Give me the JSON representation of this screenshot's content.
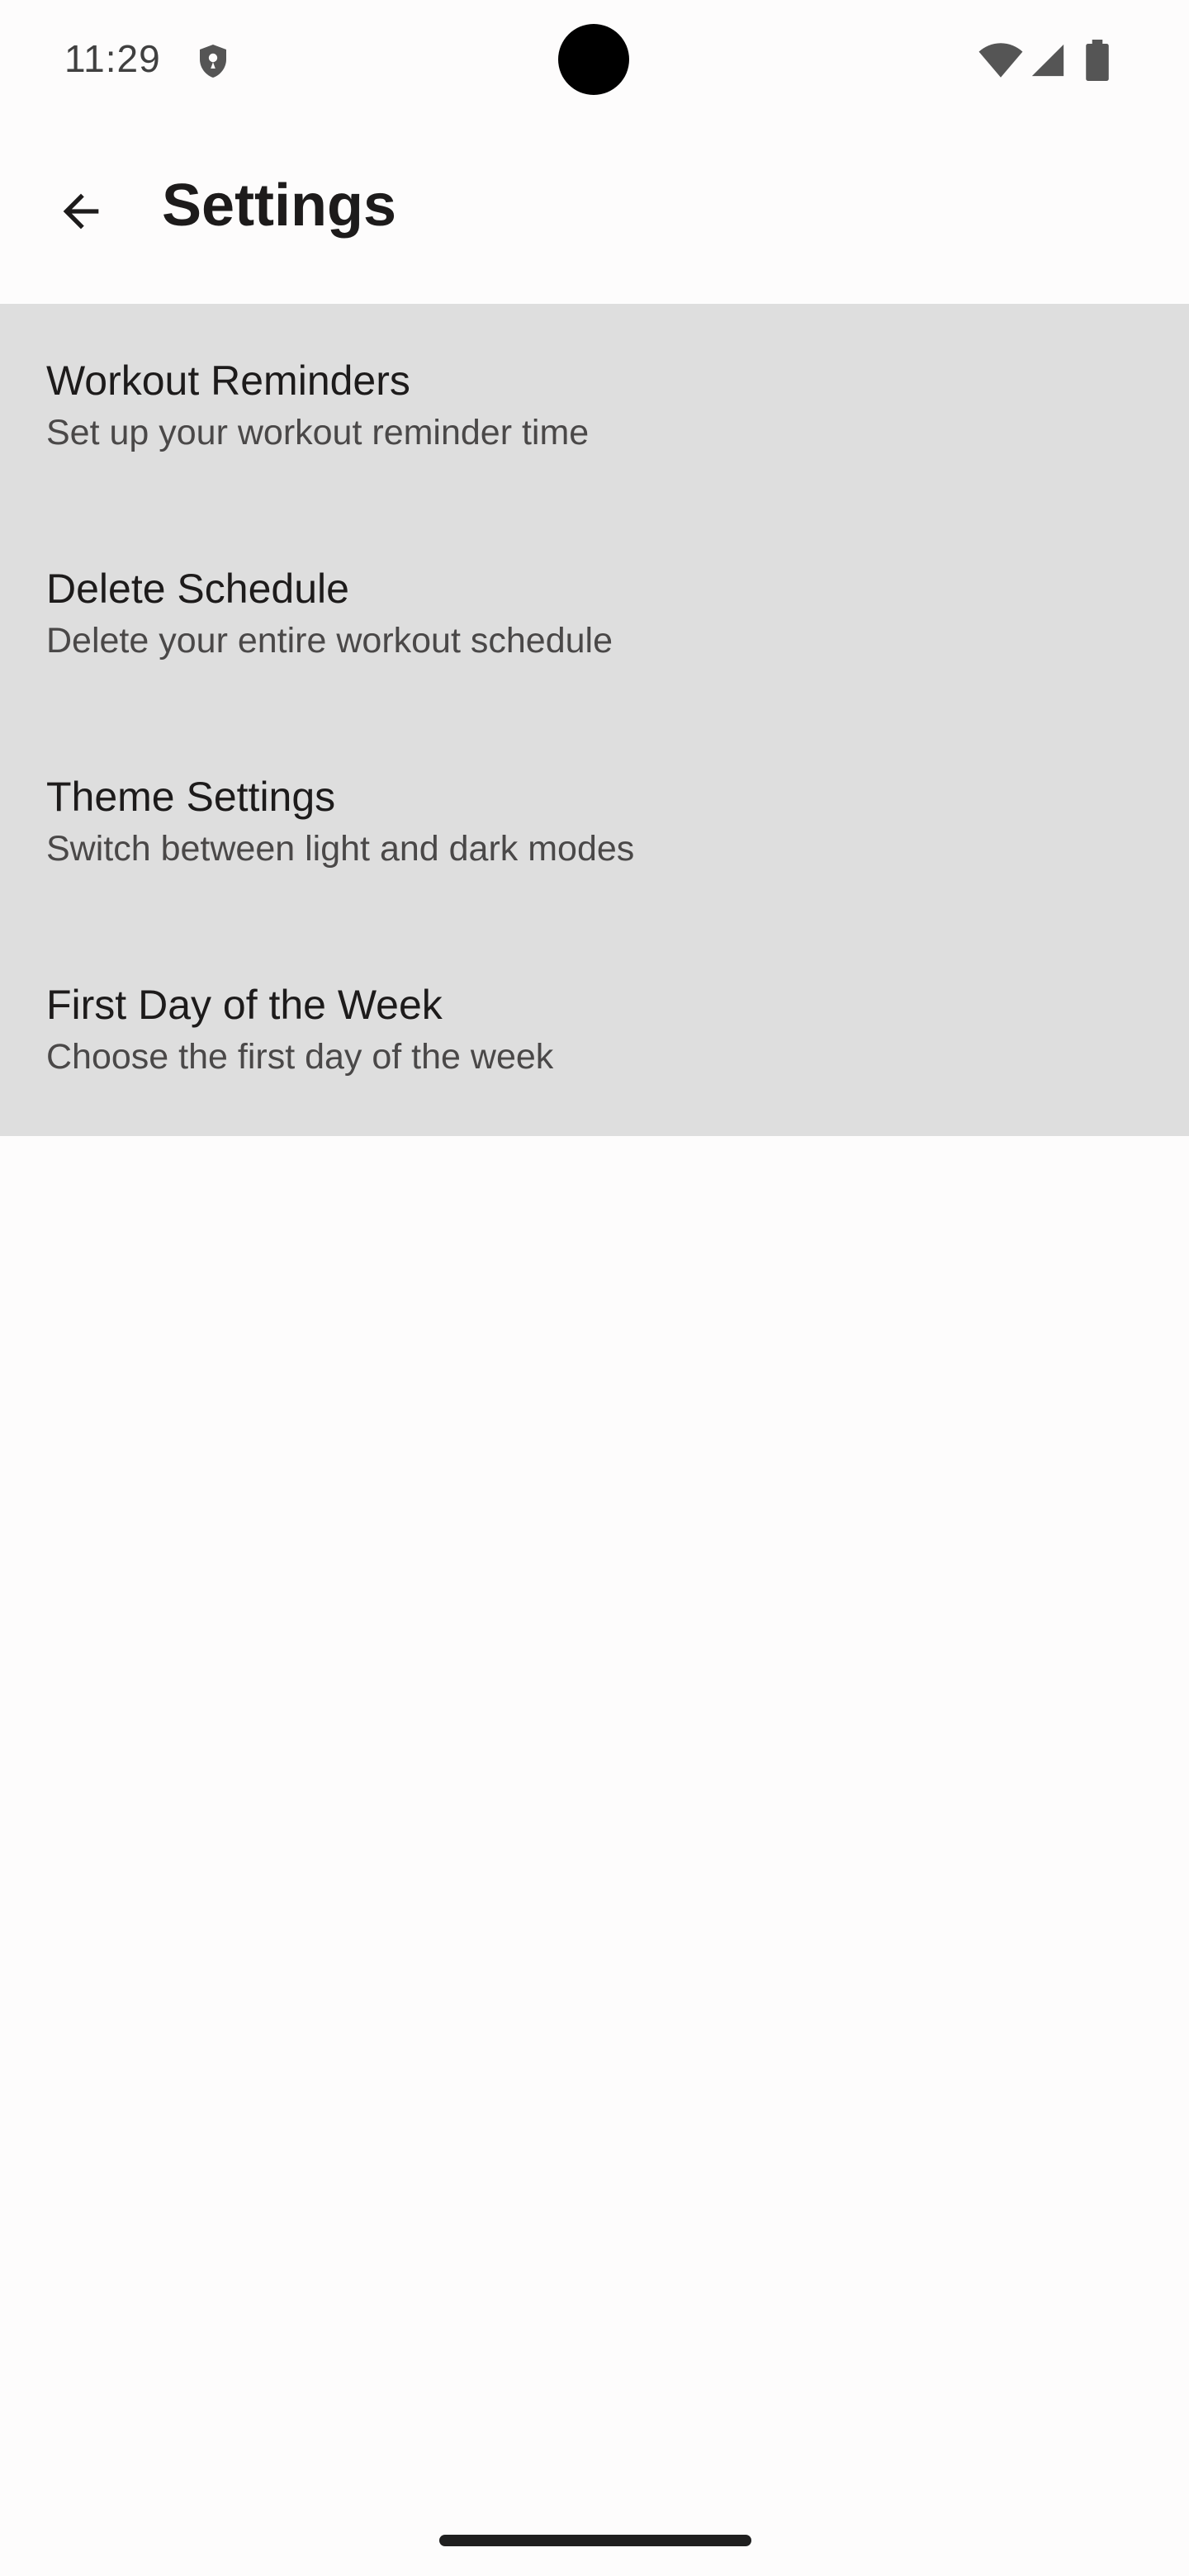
{
  "status_bar": {
    "time": "11:29"
  },
  "app_bar": {
    "title": "Settings",
    "back_icon": "arrow-back-icon"
  },
  "settings": {
    "items": [
      {
        "title": "Workout Reminders",
        "subtitle": "Set up your workout reminder time"
      },
      {
        "title": "Delete Schedule",
        "subtitle": "Delete your entire workout schedule"
      },
      {
        "title": "Theme Settings",
        "subtitle": "Switch between light and dark modes"
      },
      {
        "title": "First Day of the Week",
        "subtitle": "Choose the first day of the week"
      }
    ]
  },
  "colors": {
    "background": "#fdfcfc",
    "list_background": "#dedede",
    "title_text": "#1d1b1b",
    "subtitle_text": "#4a4848"
  }
}
